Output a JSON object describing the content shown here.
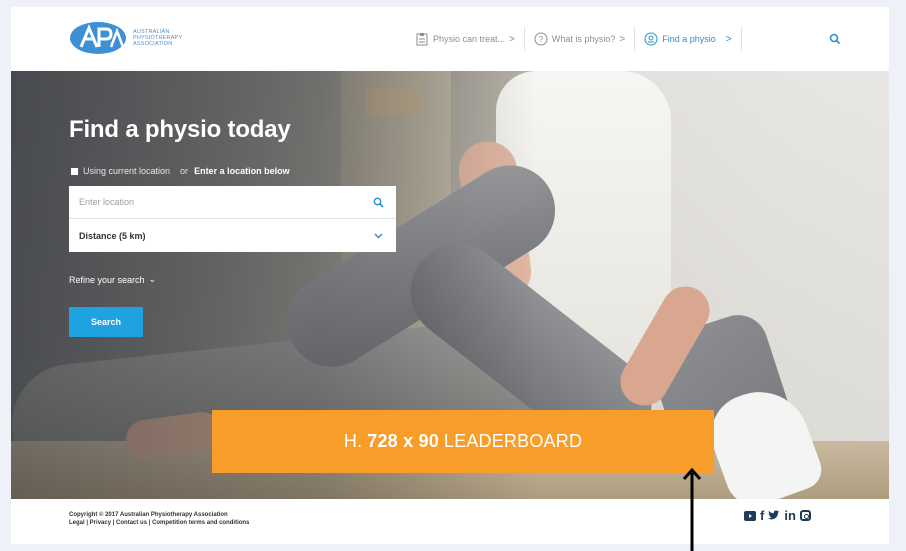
{
  "header": {
    "logo": {
      "line1": "AUSTRALIAN",
      "line2": "PHYSIOTHERAPY",
      "line3": "ASSOCIATION"
    },
    "nav": [
      {
        "label": "Physio can treat...",
        "icon": "clipboard-icon"
      },
      {
        "label": "What is physio?",
        "icon": "question-icon"
      },
      {
        "label": "Find a physio",
        "icon": "location-icon",
        "active": true
      }
    ],
    "search_icon": "search-icon"
  },
  "hero": {
    "title": "Find a physio today",
    "location_current": "Using current location",
    "location_or": "or",
    "location_enter": "Enter a location below",
    "location_placeholder": "Enter location",
    "distance_label": "Distance (5 km)",
    "refine_label": "Refine your search",
    "search_button": "Search"
  },
  "leaderboard": {
    "prefix": "H.",
    "size": "728 x 90",
    "suffix": "LEADERBOARD"
  },
  "footer": {
    "copyright": "Copyright © 2017 Australian Physiotherapy Association",
    "links": "Legal | Privacy | Contact us | Competition terms and conditions",
    "social": [
      "youtube-icon",
      "facebook-icon",
      "twitter-icon",
      "linkedin-icon",
      "instagram-icon"
    ]
  },
  "colors": {
    "brand_blue": "#2e8fd6",
    "button_blue": "#1fa2e0",
    "leaderboard_orange": "#f99d2a",
    "footer_icons": "#1f3b57"
  }
}
